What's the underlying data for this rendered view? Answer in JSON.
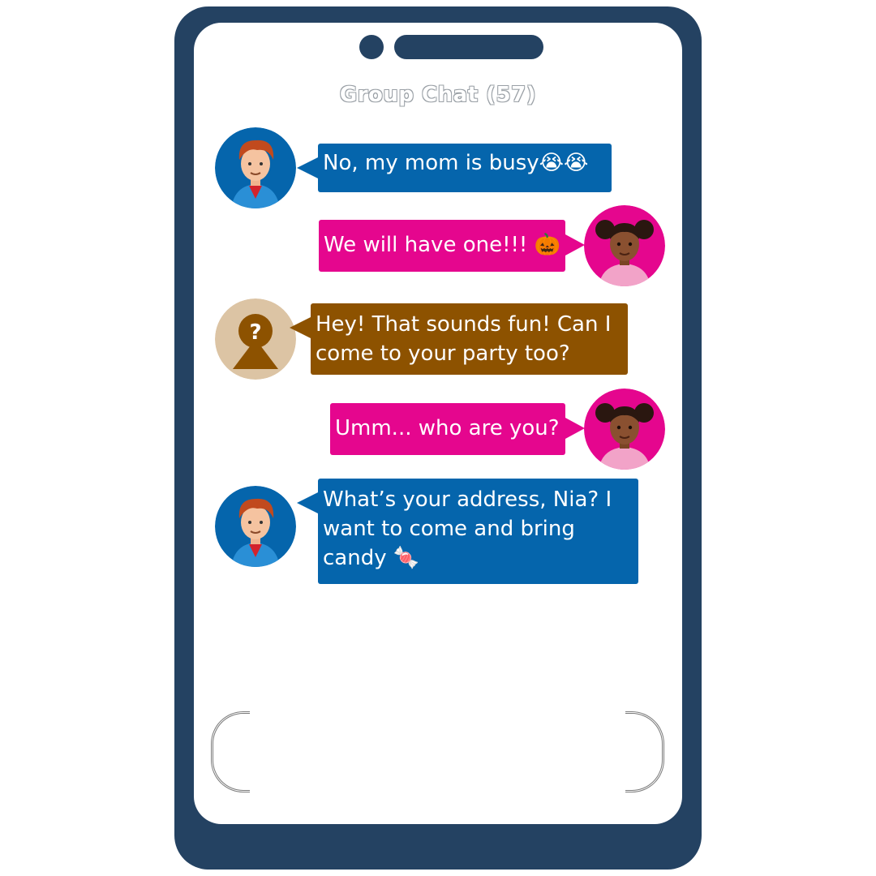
{
  "chat": {
    "title": "Group Chat (57)"
  },
  "messages": [
    {
      "sender": "boy",
      "side": "left",
      "color": "#0565ac",
      "text": "No, my mom is busy😭😭"
    },
    {
      "sender": "nia",
      "side": "right",
      "color": "#e5068e",
      "text": "We will have one!!! 🎃"
    },
    {
      "sender": "unknown",
      "side": "left",
      "color": "#8d5200",
      "text": "Hey! That sounds fun! Can I come to your party too?"
    },
    {
      "sender": "nia",
      "side": "right",
      "color": "#e5068e",
      "text": "Umm... who are you?"
    },
    {
      "sender": "boy",
      "side": "left",
      "color": "#0565ac",
      "text": "What’s your address, Nia? I want to come and bring candy 🍬"
    }
  ],
  "icons": {
    "unknown_avatar": "question-mark-person-icon"
  },
  "colors": {
    "phone_frame": "#244262",
    "boy_bubble": "#0565ac",
    "nia_bubble": "#e5068e",
    "unknown_bubble": "#8d5200",
    "unknown_avatar_bg": "#dcc4a4"
  }
}
